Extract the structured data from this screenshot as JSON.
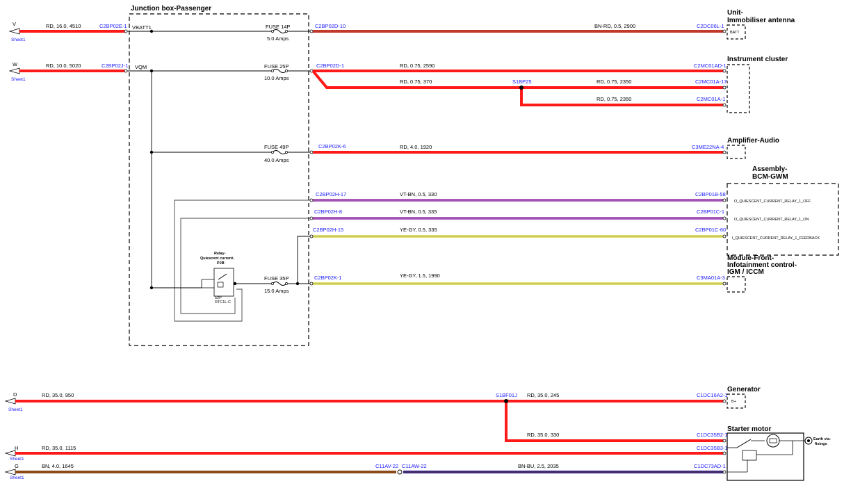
{
  "colors": {
    "red": "#ff1a1a",
    "brown_red": "#c0392b",
    "violet": "#c066c0",
    "yellow": "#dede60",
    "brown": "#8b4a1a",
    "blue": "#1a1aa0",
    "dark": "#000000",
    "connector_text": "#1a1aff"
  },
  "junction_box": {
    "title": "Junction box-Passenger",
    "vbatt": "VBATT1",
    "vqm": "VQM",
    "fuses": [
      {
        "name": "FUSE 14P",
        "rating": "5.0 Amps"
      },
      {
        "name": "FUSE 25P",
        "rating": "10.0 Amps"
      },
      {
        "name": "FUSE 49P",
        "rating": "40.0 Amps"
      },
      {
        "name": "FUSE 35P",
        "rating": "15.0 Amps"
      }
    ],
    "relay": {
      "title_l1": "Relay-",
      "title_l2": "Quiescent current-",
      "title_l3": "PJB",
      "code1": "52P",
      "code2": "RTC1L-C"
    }
  },
  "inputs": [
    {
      "letter": "V",
      "sheet": "Sheet1",
      "wire": "RD,  16.0,  4510",
      "conn": "C2BP02E-1"
    },
    {
      "letter": "W",
      "sheet": "Sheet1",
      "wire": "RD,  10.0,  5020",
      "conn": "C2BP02J-1"
    },
    {
      "letter": "D",
      "sheet": "Sheet1",
      "wire": "RD,  35.0,  950",
      "conn": ""
    },
    {
      "letter": "H",
      "sheet": "Sheet1",
      "wire": "RD,  35.0,  1115",
      "conn": ""
    },
    {
      "letter": "G",
      "sheet": "Sheet1",
      "wire": "BN,  4.0,  1645",
      "conn": "C11AV-22"
    }
  ],
  "wires": [
    {
      "start": "C2BP02D-10",
      "spec": "BN-RD,  0.5,  2900",
      "end": "C2DC06L-1"
    },
    {
      "start": "C2BP02D-1",
      "spec": "RD,  0.75,  2590",
      "end": "C2MC01AD-1"
    },
    {
      "start": "",
      "spec": "RD,  0.75,  370",
      "end": ""
    },
    {
      "start": "",
      "spec": "RD,  0.75,  2350",
      "end": "C2MC01A-17"
    },
    {
      "start": "",
      "spec": "RD,  0.75,  2350",
      "end": "C2MC01A-1"
    },
    {
      "start": "C2BP02K-6",
      "spec": "RD,  4.0,  1920",
      "end": "C3ME22NA-4"
    },
    {
      "start": "C2BP02H-17",
      "spec": "VT-BN,  0.5,  330",
      "end": "C2BP01B-58"
    },
    {
      "start": "C2BP02H-8",
      "spec": "VT-BN,  0.5,  335",
      "end": "C2BP01C-1"
    },
    {
      "start": "C2BP02H-15",
      "spec": "YE-GY,  0.5,  335",
      "end": "C2BP01C-60"
    },
    {
      "start": "C2BP02K-1",
      "spec": "YE-GY,  1.5,  1990",
      "end": "C3MA01A-3"
    },
    {
      "start": "S1BF01J",
      "spec": "RD,  35.0,  245",
      "end": "C1DC16A2-1"
    },
    {
      "start": "",
      "spec": "RD,  35.0,  330",
      "end": "C1DC35B2-1"
    },
    {
      "start": "",
      "spec": "",
      "end": "C1DC35B3-1"
    },
    {
      "start": "C11AW-22",
      "spec": "BN-BU,  2.5,  2035",
      "end": "C1DC73AD-1"
    }
  ],
  "splices": [
    "S1BP25",
    "S1BF01J"
  ],
  "components": {
    "immobiliser": {
      "title_l1": "Unit-",
      "title_l2": "Immobiliser antenna",
      "pin": "BATT"
    },
    "cluster": {
      "title": "Instrument cluster"
    },
    "amplifier": {
      "title": "Amplifier-Audio"
    },
    "bcm": {
      "title_l1": "Assembly-",
      "title_l2": "BCM-GWM",
      "pins": [
        "O_QUIESCENT_CURRENT_RELAY_1_OFF",
        "O_QUIESCENT_CURRENT_RELAY_1_ON",
        "I_QUIESCENT_CURRENT_RELAY_1_FEEDBACK"
      ]
    },
    "infotainment": {
      "title_l1": "Module-Front-",
      "title_l2": "Infotainment control-",
      "title_l3": "IGM / ICCM"
    },
    "generator": {
      "title": "Generator",
      "pin": "B+"
    },
    "starter": {
      "title": "Starter motor",
      "earth_l1": "Earth via-",
      "earth_l2": "fixings"
    }
  }
}
